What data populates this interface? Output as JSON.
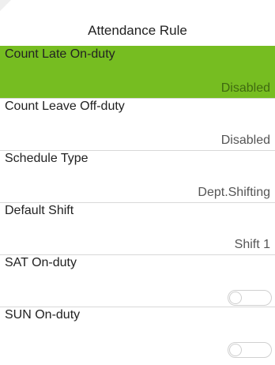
{
  "header": {
    "title": "Attendance Rule"
  },
  "rules": [
    {
      "label": "Count Late On-duty",
      "value": "Disabled",
      "selected": true
    },
    {
      "label": "Count Leave Off-duty",
      "value": "Disabled",
      "selected": false
    },
    {
      "label": "Schedule Type",
      "value": "Dept.Shifting",
      "selected": false
    },
    {
      "label": "Default Shift",
      "value": "Shift 1",
      "selected": false
    },
    {
      "label": "SAT On-duty",
      "toggle": "off",
      "selected": false
    },
    {
      "label": "SUN On-duty",
      "toggle": "off",
      "selected": false
    }
  ],
  "colors": {
    "selected_row": "#76bd21",
    "divider": "#d8d8d8",
    "background": "#ffffff"
  }
}
